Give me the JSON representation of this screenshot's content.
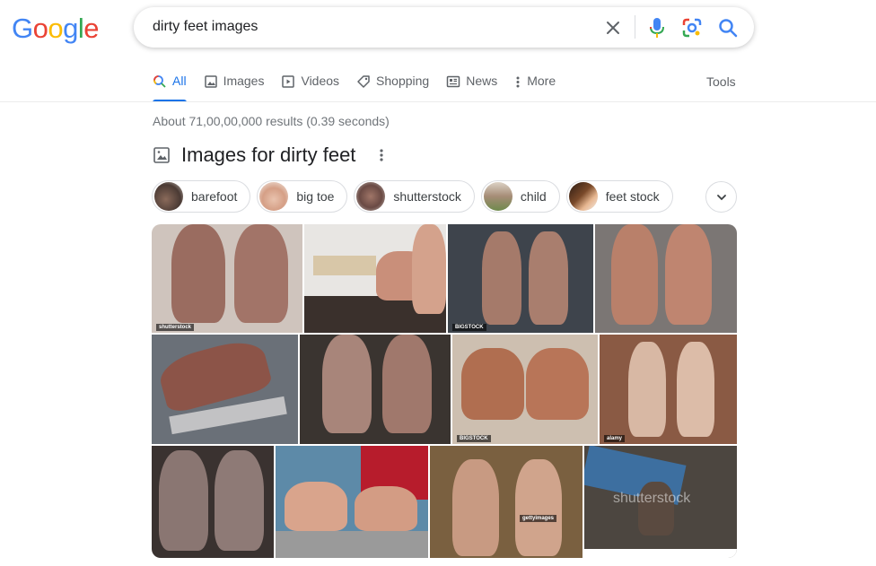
{
  "search": {
    "query": "dirty feet images"
  },
  "logo": {
    "text": [
      "G",
      "o",
      "o",
      "g",
      "l",
      "e"
    ],
    "colors": [
      "#4285F4",
      "#EA4335",
      "#FBBC05",
      "#4285F4",
      "#34A853",
      "#EA4335"
    ]
  },
  "tabs": [
    {
      "label": "All",
      "icon": "search-icon",
      "active": true
    },
    {
      "label": "Images",
      "icon": "image-icon"
    },
    {
      "label": "Videos",
      "icon": "play-icon"
    },
    {
      "label": "Shopping",
      "icon": "tag-icon"
    },
    {
      "label": "News",
      "icon": "news-icon"
    },
    {
      "label": "More",
      "icon": "more-vert-icon"
    }
  ],
  "tools_label": "Tools",
  "stats": "About 71,00,00,000 results (0.39 seconds)",
  "images_section": {
    "title": "Images for dirty feet"
  },
  "chips": [
    {
      "label": "barefoot"
    },
    {
      "label": "big toe"
    },
    {
      "label": "shutterstock"
    },
    {
      "label": "child"
    },
    {
      "label": "feet stock"
    }
  ],
  "watermarks": {
    "shutterstock": "shutterstock",
    "bigstock": "BIGSTOCK",
    "alamy": "alamy",
    "gettyimages": "gettyimages",
    "shutterstock_overlay": "shutterstock"
  },
  "colors": {
    "accent": "#1a73e8",
    "muted": "#5f6368",
    "stats": "#70757a"
  }
}
